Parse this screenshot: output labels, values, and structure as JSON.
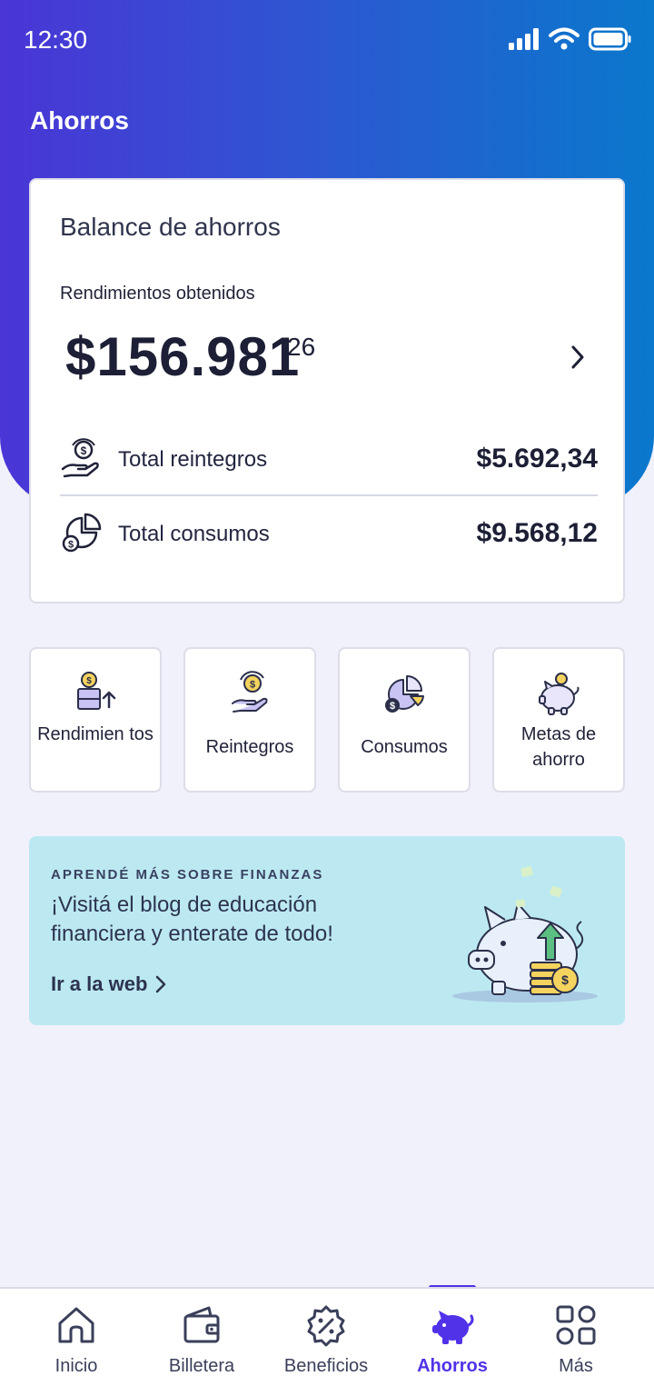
{
  "status": {
    "time": "12:30"
  },
  "header": {
    "title": "Ahorros"
  },
  "balance": {
    "title": "Balance de ahorros",
    "yield_label": "Rendimientos obtenidos",
    "yield_amount": "$156.981",
    "yield_cents": "26",
    "rows": [
      {
        "label": "Total reintegros",
        "value": "$5.692,34",
        "icon": "hand-coin-icon"
      },
      {
        "label": "Total consumos",
        "value": "$9.568,12",
        "icon": "pie-coin-icon"
      }
    ]
  },
  "tiles": [
    {
      "label": "Rendimien tos",
      "icon": "yield-icon"
    },
    {
      "label": "Reintegros",
      "icon": "refund-icon"
    },
    {
      "label": "Consumos",
      "icon": "consumption-icon"
    },
    {
      "label": "Metas de ahorro",
      "icon": "piggy-goal-icon"
    }
  ],
  "promo": {
    "kicker": "APRENDÉ MÁS SOBRE FINANZAS",
    "text": "¡Visitá el blog de educación financiera y enterate de todo!",
    "link": "Ir a la web",
    "art": "piggy-bank-illustration"
  },
  "nav": {
    "items": [
      {
        "label": "Inicio",
        "icon": "home-icon"
      },
      {
        "label": "Billetera",
        "icon": "wallet-icon"
      },
      {
        "label": "Beneficios",
        "icon": "discount-badge-icon"
      },
      {
        "label": "Ahorros",
        "icon": "piggy-bank-icon",
        "active": true
      },
      {
        "label": "Más",
        "icon": "grid-icon"
      }
    ]
  },
  "colors": {
    "accent": "#5132e8",
    "header_gradient_start": "#4a35d6",
    "header_gradient_end": "#0a78cc",
    "promo_bg": "#bce9f1"
  }
}
